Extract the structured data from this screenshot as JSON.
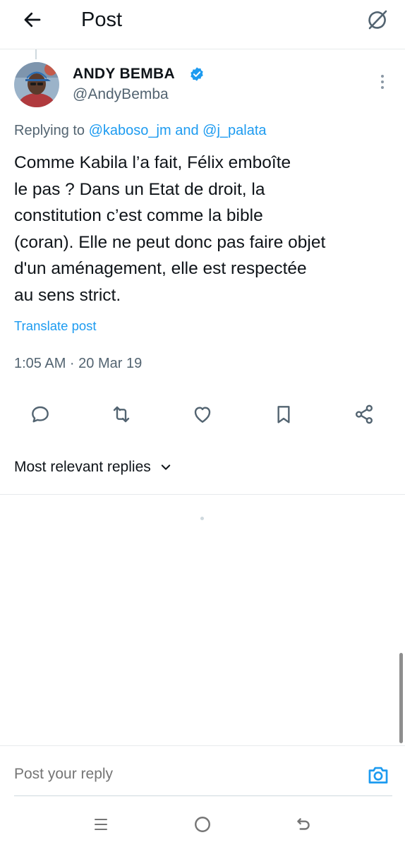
{
  "header": {
    "title": "Post",
    "back_icon": "arrow-left-icon",
    "grok_icon": "grok-icon"
  },
  "post": {
    "author_name": "ANDY BEMBA",
    "author_handle": "@AndyBemba",
    "verified": true,
    "verified_color": "#1d9bf0",
    "replying_prefix": "Replying to",
    "replying_mention_1": "@kaboso_jm",
    "replying_and": "and",
    "replying_mention_2": "@j_palata",
    "text": "Comme Kabila l’a fait, Félix emboîte\nle pas ? Dans un Etat de droit, la\nconstitution c’est comme la bible\n(coran). Elle ne peut donc pas faire objet\nd'un aménagement, elle est respectée\nau sens strict.",
    "translate_label": "Translate post",
    "timestamp": "1:05 AM · 20 Mar 19"
  },
  "actions": [
    "reply-icon",
    "repost-icon",
    "like-icon",
    "bookmark-icon",
    "share-icon"
  ],
  "replies": {
    "sort_label": "Most relevant replies",
    "sort_icon": "chevron-down-icon"
  },
  "reply_box": {
    "placeholder": "Post your reply",
    "camera_icon": "camera-icon"
  },
  "colors": {
    "accent": "#1d9bf0",
    "text_primary": "#0f1419",
    "text_secondary": "#536471"
  }
}
